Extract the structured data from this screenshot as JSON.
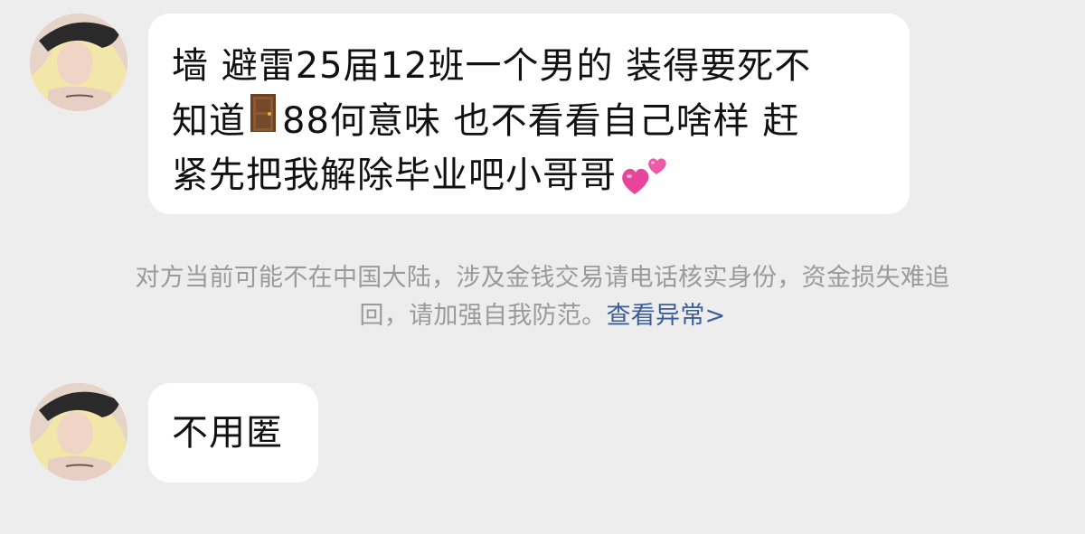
{
  "messages": [
    {
      "avatar": "avatar-icon",
      "lines": [
        "墙 避雷25届12班一个男的 装得要死不",
        [
          "知道",
          "88何意味 也不看看自己啥样 赶"
        ],
        "紧先把我解除毕业吧小哥哥"
      ],
      "emoji": [
        "door-emoji",
        "two-hearts-emoji"
      ]
    },
    {
      "avatar": "avatar-icon",
      "text": "不用匿"
    }
  ],
  "notice": {
    "line1": "对方当前可能不在中国大陆，涉及金钱交易请电话核实身份，资金损失难追",
    "line2": "回，请加强自我防范。",
    "link": "查看异常>"
  },
  "colors": {
    "background": "#ededed",
    "bubble": "#ffffff",
    "notice_text": "#9a9a9a",
    "link": "#3a5f98"
  }
}
